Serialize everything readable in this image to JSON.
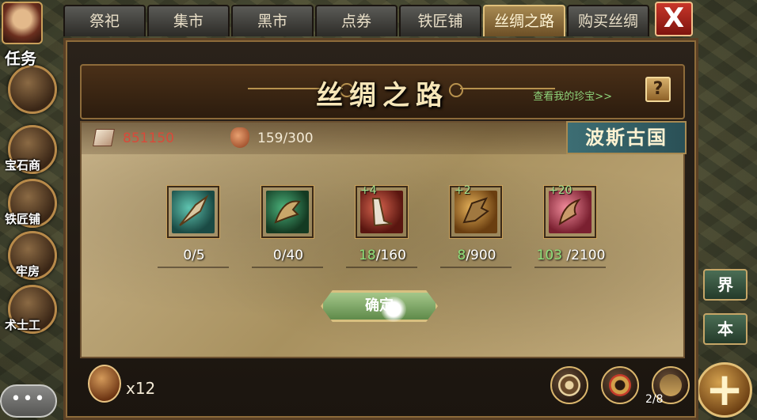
{
  "side_left": {
    "task_label": "任务",
    "gem_shop_label": "宝石商",
    "blacksmith_label": "铁匠铺",
    "prison_label": "牢房",
    "sorcerer_label": "术士工"
  },
  "side_right": {
    "world_label": "界",
    "instance_label": "本"
  },
  "tabs": [
    {
      "label": "祭祀",
      "active": false
    },
    {
      "label": "集市",
      "active": false
    },
    {
      "label": "黑市",
      "active": false
    },
    {
      "label": "点券",
      "active": false
    },
    {
      "label": "铁匠铺",
      "active": false
    },
    {
      "label": "丝绸之路",
      "active": true
    },
    {
      "label": "购买丝绸",
      "active": false
    }
  ],
  "close_glyph": "X",
  "panel": {
    "title": "丝绸之路",
    "treasure_link": "查看我的珍宝>>",
    "help_glyph": "?"
  },
  "stats": {
    "resource_value": "851150",
    "bag_value": "159/300",
    "region_name": "波斯古国"
  },
  "items": [
    {
      "icon": "green-dagger-icon",
      "plus": "",
      "have": "0",
      "need": "/5",
      "have_green": false
    },
    {
      "icon": "green-claw-icon",
      "plus": "",
      "have": "0",
      "need": "/40",
      "have_green": false
    },
    {
      "icon": "red-blade-icon",
      "plus": "+4",
      "have": "18",
      "need": "/160",
      "have_green": true
    },
    {
      "icon": "gold-claw-icon",
      "plus": "+2",
      "have": "8",
      "need": "/900",
      "have_green": true
    },
    {
      "icon": "red-hook-icon",
      "plus": "+20",
      "have": "103",
      "need": " /2100",
      "have_green": true
    }
  ],
  "confirm_label": "确定",
  "footer": {
    "token_qty": "x12",
    "slot_count": "2/8"
  },
  "chat_label": "•••"
}
